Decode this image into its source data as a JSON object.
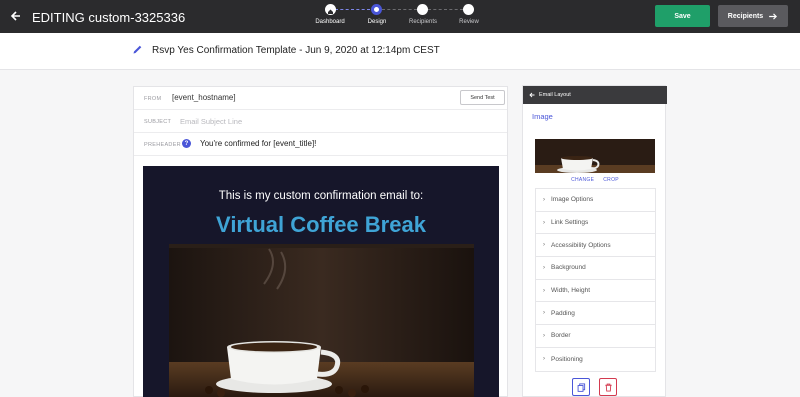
{
  "topbar": {
    "title": "EDITING custom-3325336",
    "steps": [
      {
        "label": "Dashboard"
      },
      {
        "label": "Design"
      },
      {
        "label": "Recipients"
      },
      {
        "label": "Review"
      }
    ],
    "save_label": "Save",
    "recipients_label": "Recipients"
  },
  "template": {
    "title": "Rsvp Yes Confirmation Template - Jun 9, 2020 at 12:14pm CEST"
  },
  "fields": {
    "from_label": "FROM",
    "from_value": "[event_hostname]",
    "send_test_label": "Send Test",
    "subject_label": "SUBJECT",
    "subject_placeholder": "Email Subject Line",
    "preheader_label": "PREHEADER",
    "preheader_help": "?",
    "preheader_value": "You're confirmed for [event_title]!"
  },
  "email": {
    "intro": "This is my custom confirmation email to:",
    "heading": "Virtual Coffee Break"
  },
  "sidebar": {
    "header": "Email Layout",
    "section_title": "Image",
    "change_label": "CHANGE",
    "crop_label": "CROP",
    "options": [
      {
        "label": "Image Options"
      },
      {
        "label": "Link Settings"
      },
      {
        "label": "Accessibility Options"
      },
      {
        "label": "Background"
      },
      {
        "label": "Width, Height"
      },
      {
        "label": "Padding"
      },
      {
        "label": "Border"
      },
      {
        "label": "Positioning"
      }
    ]
  },
  "colors": {
    "accent": "#4a56d8",
    "save": "#1f9f69",
    "heading": "#3fa4d6",
    "email_bg": "#16162a",
    "delete": "#d33a4f"
  }
}
